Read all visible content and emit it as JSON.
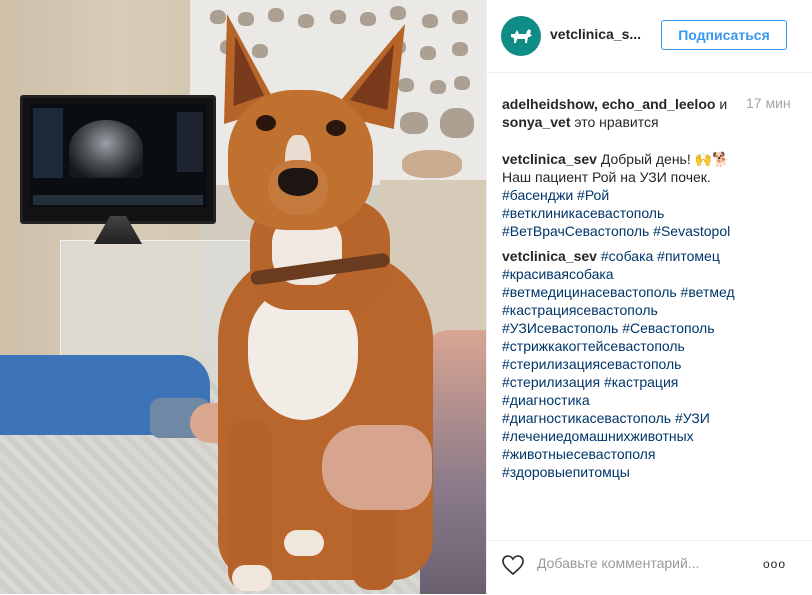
{
  "post": {
    "username": "vetclinica_s...",
    "follow_label": "Подписаться",
    "likes": {
      "names": "adelheidshow, echo_and_leeloo",
      "conj": " и ",
      "name_last": "sonya_vet",
      "suffix": " это нравится"
    },
    "time": "17 мин",
    "caption": {
      "author": "vetclinica_sev",
      "text1": " Добрый день! 🙌🐕",
      "text2": "Наш пациент Рой на УЗИ почек.",
      "tags": [
        "#басенджи #Рой",
        "#ветклиникасевастополь",
        "#ВетВрачСевастополь #Sevastopol"
      ]
    },
    "comment": {
      "author": "vetclinica_sev",
      "first_line_tags": " #собака #питомец",
      "tags": [
        "#красиваясобака",
        "#ветмедицинасевастополь #ветмед",
        "#кастрациясевастополь",
        "#УЗИсевастополь #Севастополь",
        "#стрижкакогтейсевастополь",
        "#стерилизациясевастополь",
        "#стерилизация #кастрация",
        "#диагностика",
        "#диагностикасевастополь #УЗИ",
        "#лечениедомашнихживотных",
        "#животныесевастополя",
        "#здоровыепитомцы"
      ]
    },
    "add_comment_placeholder": "Добавьте комментарий...",
    "more_label": "ooo"
  },
  "colors": {
    "accent": "#3897f0",
    "hashtag": "#003569",
    "avatar_bg": "#0e8c86"
  },
  "icons": [
    "dog-logo-icon",
    "heart-icon",
    "more-options-icon"
  ]
}
